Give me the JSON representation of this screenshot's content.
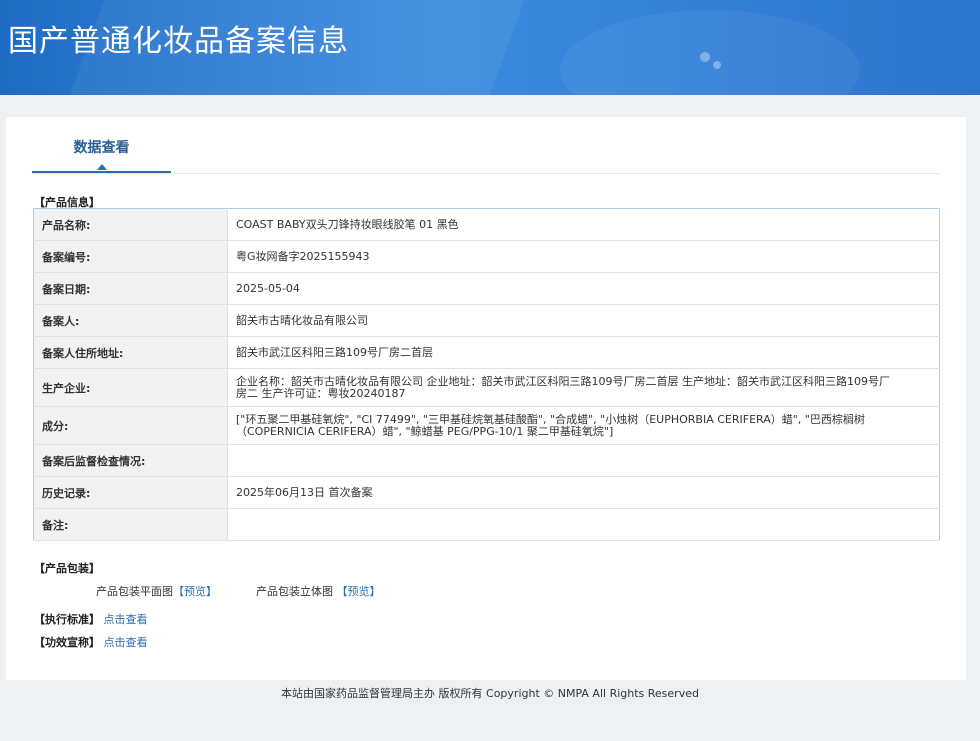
{
  "header": {
    "title": "国产普通化妆品备案信息"
  },
  "tabs": [
    {
      "label": "数据查看",
      "active": true
    }
  ],
  "product_info": {
    "section_title": "【产品信息】",
    "rows": [
      {
        "key": "产品名称:",
        "value": "COAST BABY双头刀锋持妆眼线胶笔 01 黑色"
      },
      {
        "key": "备案编号:",
        "value": "粤G妆网备字2025155943"
      },
      {
        "key": "备案日期:",
        "value": "2025-05-04"
      },
      {
        "key": "备案人:",
        "value": "韶关市古晴化妆品有限公司"
      },
      {
        "key": "备案人住所地址:",
        "value": "韶关市武江区科阳三路109号厂房二首层"
      },
      {
        "key": "生产企业:",
        "value": "企业名称：韶关市古晴化妆品有限公司 企业地址：韶关市武江区科阳三路109号厂房二首层 生产地址：韶关市武江区科阳三路109号厂房二 生产许可证：粤妆20240187"
      },
      {
        "key": "成分:",
        "value": "[\"环五聚二甲基硅氧烷\", \"CI 77499\", \"三甲基硅烷氧基硅酸酯\", \"合成蜡\", \"小烛树（EUPHORBIA CERIFERA）蜡\", \"巴西棕榈树（COPERNICIA CERIFERA）蜡\", \"鲸蜡基 PEG/PPG-10/1 聚二甲基硅氧烷\"]"
      },
      {
        "key": "备案后监督检查情况:",
        "value": ""
      },
      {
        "key": "历史记录:",
        "value": "2025年06月13日 首次备案"
      },
      {
        "key": "备注:",
        "value": ""
      }
    ]
  },
  "packaging": {
    "section_title": "【产品包装】",
    "flat_label": "产品包装平面图",
    "flat_link": "【预览】",
    "solid_label": "产品包装立体图",
    "solid_link": "【预览】"
  },
  "standard": {
    "label": "【执行标准】",
    "link": "点击查看"
  },
  "efficacy": {
    "label": "【功效宣称】",
    "link": "点击查看"
  },
  "footer": {
    "text": "本站由国家药品监督管理局主办 版权所有 Copyright © NMPA All Rights Reserved"
  }
}
